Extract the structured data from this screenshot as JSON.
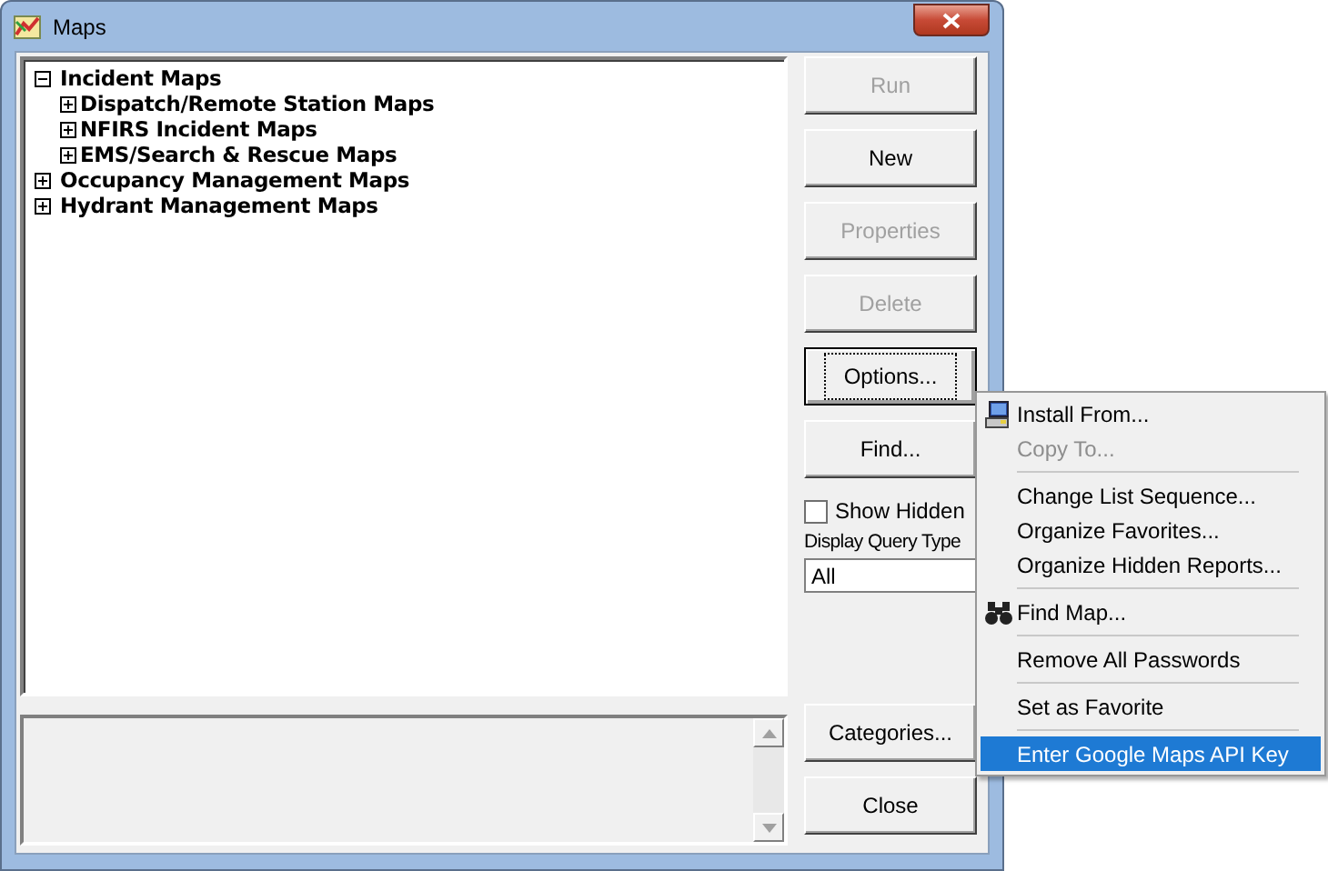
{
  "window": {
    "title": "Maps"
  },
  "tree": [
    {
      "label": "Incident Maps",
      "expanded": true,
      "children": [
        {
          "label": "Dispatch/Remote Station Maps",
          "expanded": false
        },
        {
          "label": "NFIRS Incident Maps",
          "expanded": false
        },
        {
          "label": "EMS/Search & Rescue Maps",
          "expanded": false
        }
      ]
    },
    {
      "label": "Occupancy Management Maps",
      "expanded": false
    },
    {
      "label": "Hydrant Management Maps",
      "expanded": false
    }
  ],
  "buttons": [
    {
      "label": "Run",
      "disabled": true,
      "focused": false
    },
    {
      "label": "New",
      "disabled": false,
      "focused": false
    },
    {
      "label": "Properties",
      "disabled": true,
      "focused": false
    },
    {
      "label": "Delete",
      "disabled": true,
      "focused": false
    },
    {
      "label": "Options...",
      "disabled": false,
      "focused": true
    },
    {
      "label": "Find...",
      "disabled": false,
      "focused": false
    }
  ],
  "show_hidden": {
    "label": "Show Hidden",
    "checked": false
  },
  "query_type": {
    "label": "Display Query Type",
    "value": "All"
  },
  "bottom_buttons": [
    {
      "label": "Categories..."
    },
    {
      "label": "Close"
    }
  ],
  "menu": [
    {
      "kind": "install",
      "label": "Install From...",
      "disabled": false,
      "selected": false
    },
    {
      "kind": "item",
      "label": "Copy To...",
      "disabled": true,
      "selected": false
    },
    {
      "kind": "separator"
    },
    {
      "kind": "item",
      "label": "Change List Sequence...",
      "disabled": false,
      "selected": false
    },
    {
      "kind": "item",
      "label": "Organize Favorites...",
      "disabled": false,
      "selected": false
    },
    {
      "kind": "item",
      "label": "Organize Hidden Reports...",
      "disabled": false,
      "selected": false
    },
    {
      "kind": "separator"
    },
    {
      "kind": "find",
      "label": "Find Map...",
      "disabled": false,
      "selected": false
    },
    {
      "kind": "separator"
    },
    {
      "kind": "item",
      "label": "Remove All Passwords",
      "disabled": false,
      "selected": false
    },
    {
      "kind": "separator"
    },
    {
      "kind": "item",
      "label": "Set as Favorite",
      "disabled": false,
      "selected": false
    },
    {
      "kind": "separator"
    },
    {
      "kind": "item",
      "label": "Enter Google Maps API Key",
      "disabled": false,
      "selected": true
    }
  ]
}
